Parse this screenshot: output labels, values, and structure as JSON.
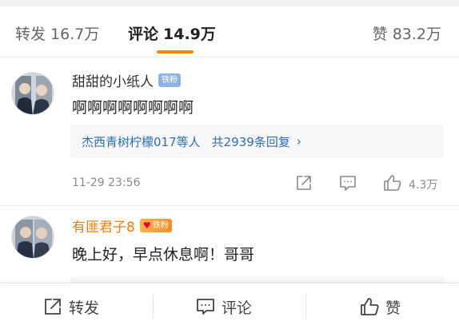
{
  "tabs": {
    "repost": {
      "label": "转发",
      "count": "16.7万"
    },
    "comment": {
      "label": "评论",
      "count": "14.9万"
    },
    "like": {
      "label": "赞",
      "count": "83.2万"
    }
  },
  "comments": [
    {
      "username": "甜甜的小纸人",
      "badge": "铁粉",
      "text": "啊啊啊啊啊啊啊啊",
      "replies": {
        "names": "杰西青树柠檬017等人",
        "total": "共2939条回复",
        "chevron": "›"
      },
      "time": "11-29 23:56",
      "likes": "4.3万"
    },
    {
      "username": "有匪君子8",
      "badge": "铁粉",
      "text": "晚上好，早点休息啊！哥哥"
    }
  ],
  "bottom_bar": {
    "repost": "转发",
    "comment": "评论",
    "like": "赞"
  },
  "colors": {
    "accent": "#ff8200",
    "link": "#2c6fb8",
    "vip_name": "#f07b0a",
    "muted": "#8a8a8a"
  },
  "icons": [
    "share-icon",
    "comment-icon",
    "thumbs-up-icon",
    "chevron-right-icon",
    "heart-icon"
  ]
}
